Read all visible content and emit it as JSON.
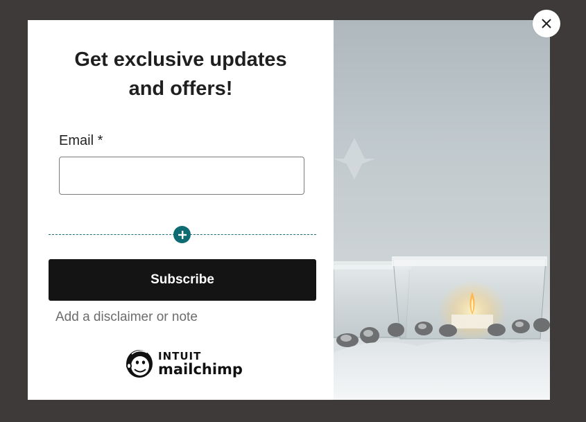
{
  "form": {
    "headline_line1": "Get exclusive updates",
    "headline_line2": "and offers!",
    "email_label": "Email *",
    "email_value": "",
    "email_placeholder": "",
    "subscribe_label": "Subscribe",
    "disclaimer": "Add a disclaimer or note"
  },
  "branding": {
    "top": "INTUIT",
    "bottom": "mailchimp"
  },
  "icons": {
    "close": "close-icon",
    "add": "plus-icon",
    "logo": "mailchimp-freddie-icon"
  },
  "colors": {
    "overlay": "#3d3a39",
    "button": "#141414",
    "accent": "#0e6b72"
  },
  "image": {
    "subject": "glass candle holders on white fluffy surface with lit candle"
  }
}
